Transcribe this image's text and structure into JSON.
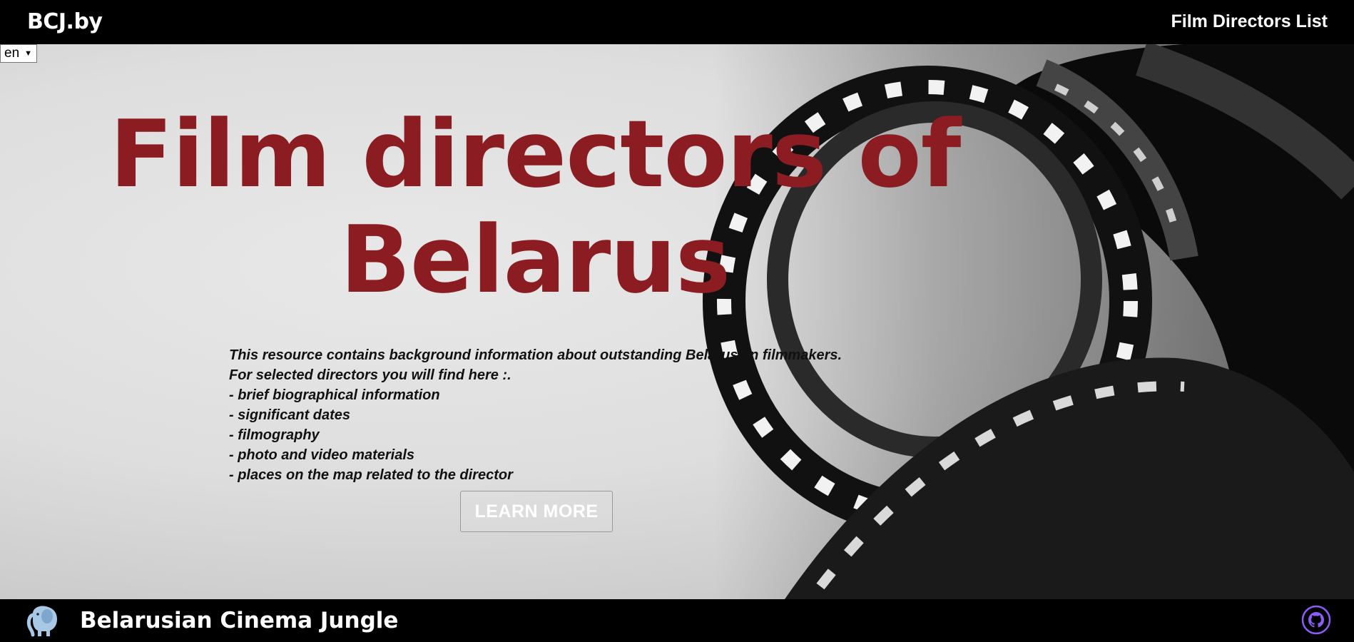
{
  "header": {
    "brand": "BCJ.by",
    "nav_link": "Film Directors List"
  },
  "language": {
    "selected": "en"
  },
  "hero": {
    "title_line1": "Film directors of",
    "title_line2": "Belarus",
    "lines": [
      "This resource contains background information about outstanding Belarusian filmmakers.",
      "For selected directors you will find here :.",
      "- brief biographical information",
      "- significant dates",
      "- filmography",
      "- photo and video materials",
      "- places on the map related to the director"
    ],
    "button_label": "LEARN MORE"
  },
  "footer": {
    "title": "Belarusian Cinema Jungle",
    "logo_icon": "elephant-icon",
    "github_icon": "github-icon"
  },
  "colors": {
    "title": "#8b1c22",
    "bar_background": "#000000",
    "github_accent": "#8b5cf6"
  }
}
